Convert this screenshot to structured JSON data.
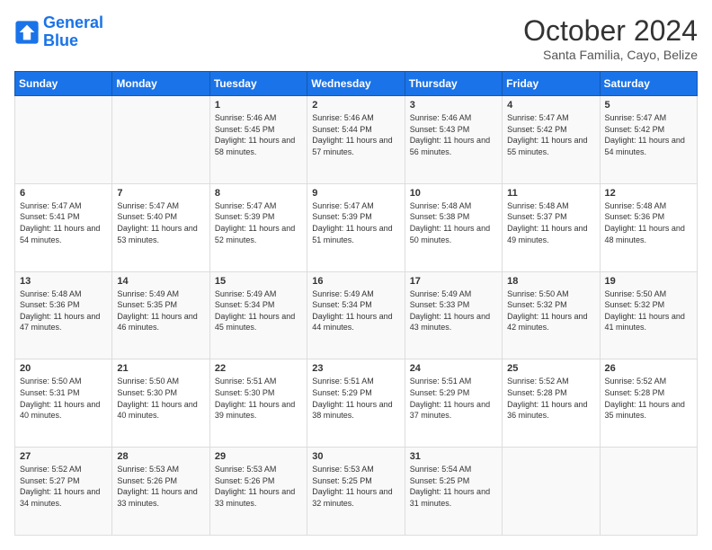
{
  "header": {
    "logo_line1": "General",
    "logo_line2": "Blue",
    "month_title": "October 2024",
    "subtitle": "Santa Familia, Cayo, Belize"
  },
  "days_of_week": [
    "Sunday",
    "Monday",
    "Tuesday",
    "Wednesday",
    "Thursday",
    "Friday",
    "Saturday"
  ],
  "weeks": [
    [
      {
        "day": "",
        "info": ""
      },
      {
        "day": "",
        "info": ""
      },
      {
        "day": "1",
        "info": "Sunrise: 5:46 AM\nSunset: 5:45 PM\nDaylight: 11 hours and 58 minutes."
      },
      {
        "day": "2",
        "info": "Sunrise: 5:46 AM\nSunset: 5:44 PM\nDaylight: 11 hours and 57 minutes."
      },
      {
        "day": "3",
        "info": "Sunrise: 5:46 AM\nSunset: 5:43 PM\nDaylight: 11 hours and 56 minutes."
      },
      {
        "day": "4",
        "info": "Sunrise: 5:47 AM\nSunset: 5:42 PM\nDaylight: 11 hours and 55 minutes."
      },
      {
        "day": "5",
        "info": "Sunrise: 5:47 AM\nSunset: 5:42 PM\nDaylight: 11 hours and 54 minutes."
      }
    ],
    [
      {
        "day": "6",
        "info": "Sunrise: 5:47 AM\nSunset: 5:41 PM\nDaylight: 11 hours and 54 minutes."
      },
      {
        "day": "7",
        "info": "Sunrise: 5:47 AM\nSunset: 5:40 PM\nDaylight: 11 hours and 53 minutes."
      },
      {
        "day": "8",
        "info": "Sunrise: 5:47 AM\nSunset: 5:39 PM\nDaylight: 11 hours and 52 minutes."
      },
      {
        "day": "9",
        "info": "Sunrise: 5:47 AM\nSunset: 5:39 PM\nDaylight: 11 hours and 51 minutes."
      },
      {
        "day": "10",
        "info": "Sunrise: 5:48 AM\nSunset: 5:38 PM\nDaylight: 11 hours and 50 minutes."
      },
      {
        "day": "11",
        "info": "Sunrise: 5:48 AM\nSunset: 5:37 PM\nDaylight: 11 hours and 49 minutes."
      },
      {
        "day": "12",
        "info": "Sunrise: 5:48 AM\nSunset: 5:36 PM\nDaylight: 11 hours and 48 minutes."
      }
    ],
    [
      {
        "day": "13",
        "info": "Sunrise: 5:48 AM\nSunset: 5:36 PM\nDaylight: 11 hours and 47 minutes."
      },
      {
        "day": "14",
        "info": "Sunrise: 5:49 AM\nSunset: 5:35 PM\nDaylight: 11 hours and 46 minutes."
      },
      {
        "day": "15",
        "info": "Sunrise: 5:49 AM\nSunset: 5:34 PM\nDaylight: 11 hours and 45 minutes."
      },
      {
        "day": "16",
        "info": "Sunrise: 5:49 AM\nSunset: 5:34 PM\nDaylight: 11 hours and 44 minutes."
      },
      {
        "day": "17",
        "info": "Sunrise: 5:49 AM\nSunset: 5:33 PM\nDaylight: 11 hours and 43 minutes."
      },
      {
        "day": "18",
        "info": "Sunrise: 5:50 AM\nSunset: 5:32 PM\nDaylight: 11 hours and 42 minutes."
      },
      {
        "day": "19",
        "info": "Sunrise: 5:50 AM\nSunset: 5:32 PM\nDaylight: 11 hours and 41 minutes."
      }
    ],
    [
      {
        "day": "20",
        "info": "Sunrise: 5:50 AM\nSunset: 5:31 PM\nDaylight: 11 hours and 40 minutes."
      },
      {
        "day": "21",
        "info": "Sunrise: 5:50 AM\nSunset: 5:30 PM\nDaylight: 11 hours and 40 minutes."
      },
      {
        "day": "22",
        "info": "Sunrise: 5:51 AM\nSunset: 5:30 PM\nDaylight: 11 hours and 39 minutes."
      },
      {
        "day": "23",
        "info": "Sunrise: 5:51 AM\nSunset: 5:29 PM\nDaylight: 11 hours and 38 minutes."
      },
      {
        "day": "24",
        "info": "Sunrise: 5:51 AM\nSunset: 5:29 PM\nDaylight: 11 hours and 37 minutes."
      },
      {
        "day": "25",
        "info": "Sunrise: 5:52 AM\nSunset: 5:28 PM\nDaylight: 11 hours and 36 minutes."
      },
      {
        "day": "26",
        "info": "Sunrise: 5:52 AM\nSunset: 5:28 PM\nDaylight: 11 hours and 35 minutes."
      }
    ],
    [
      {
        "day": "27",
        "info": "Sunrise: 5:52 AM\nSunset: 5:27 PM\nDaylight: 11 hours and 34 minutes."
      },
      {
        "day": "28",
        "info": "Sunrise: 5:53 AM\nSunset: 5:26 PM\nDaylight: 11 hours and 33 minutes."
      },
      {
        "day": "29",
        "info": "Sunrise: 5:53 AM\nSunset: 5:26 PM\nDaylight: 11 hours and 33 minutes."
      },
      {
        "day": "30",
        "info": "Sunrise: 5:53 AM\nSunset: 5:25 PM\nDaylight: 11 hours and 32 minutes."
      },
      {
        "day": "31",
        "info": "Sunrise: 5:54 AM\nSunset: 5:25 PM\nDaylight: 11 hours and 31 minutes."
      },
      {
        "day": "",
        "info": ""
      },
      {
        "day": "",
        "info": ""
      }
    ]
  ]
}
